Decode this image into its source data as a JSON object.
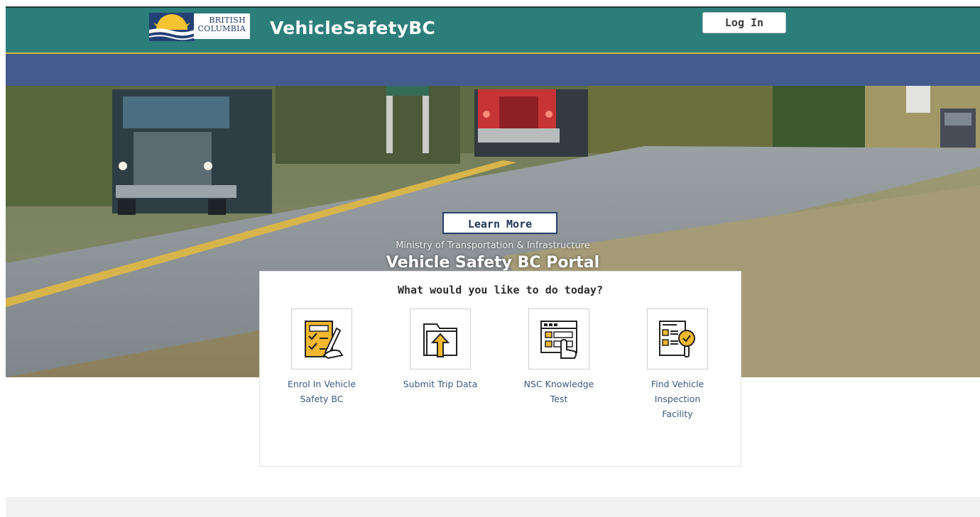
{
  "header": {
    "gov_logo_text": "BRITISH COLUMBIA",
    "gov_logo_line1": "BRITISH",
    "gov_logo_line2": "COLUMBIA",
    "site_title": "VehicleSafetyBC",
    "login_label": "Log In"
  },
  "hero": {
    "subtitle": "Ministry of Transportation & Infrastructure",
    "title": "Vehicle Safety BC Portal",
    "learn_more_label": "Learn More"
  },
  "actions": {
    "heading": "What would you like to do today?",
    "items": [
      {
        "label": "Enrol In Vehicle Safety BC",
        "icon": "enrol-form-icon"
      },
      {
        "label": "Submit Trip Data",
        "icon": "upload-folder-icon"
      },
      {
        "label": "NSC Knowledge Test",
        "icon": "online-test-icon"
      },
      {
        "label": "Find Vehicle Inspection Facility",
        "icon": "inspection-search-icon"
      }
    ]
  },
  "colors": {
    "header_bg": "#2c7e7b",
    "nav_bg": "#445b8d",
    "accent_gold": "#d9b83a",
    "icon_gold": "#f2b830",
    "link_blue": "#3d5a80"
  }
}
